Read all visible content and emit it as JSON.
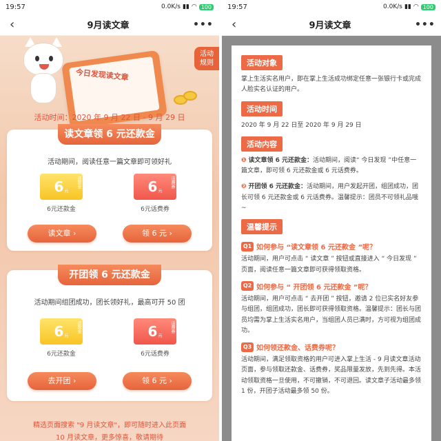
{
  "status_bar": {
    "time": "19:57",
    "net_speed": "0.0K/s",
    "battery": "100"
  },
  "nav": {
    "title": "9月读文章"
  },
  "left": {
    "rules_tab": [
      "活动",
      "规则"
    ],
    "tablet_text": "今日发现读文章",
    "activity_time": "活动时间：2020 年 9 月 22 日 - 9 月 29 日",
    "card1": {
      "title": "读文章领 6 元还款金",
      "desc": "活动期间，阅读任意一篇文章即可领好礼",
      "reward1": {
        "amount": "6",
        "unit": "元",
        "tag": "还款金",
        "label": "6元还款金"
      },
      "reward2": {
        "amount": "6",
        "unit": "元",
        "tag": "话费券",
        "label": "6元话费券"
      },
      "btn_left": "读文章 ›",
      "btn_right": "领 6 元 ›"
    },
    "card2": {
      "title": "开团领 6 元还款金",
      "desc": "活动期间组团成功，团长领好礼，最高可开 50 团",
      "reward1": {
        "amount": "6",
        "unit": "元",
        "tag": "还款金",
        "label": "6元还款金"
      },
      "reward2": {
        "amount": "6",
        "unit": "元",
        "tag": "话费券",
        "label": "6元话费券"
      },
      "btn_left": "去开团 ›",
      "btn_right": "领 6 元 ›"
    },
    "footer_line1": "精选页面搜索 \"9 月读文章\"，即可随时进入此页面",
    "footer_line2": "10 月读文章，更多惊喜，敬请期待"
  },
  "right": {
    "sec1_head": "活动对象",
    "sec1_text": "掌上生活实名用户，即在掌上生活成功绑定任意一张银行卡或完成人脸实名认证的用户。",
    "sec2_head": "活动时间",
    "sec2_text": "2020 年 9 月 22 日至 2020 年 9 月 29 日",
    "sec3_head": "活动内容",
    "sec3_item1_marker": "❶",
    "sec3_item1_bold": "读文章领 6 元还款金：",
    "sec3_item1_text": "活动期间，阅读“ 今日发现 ”中任意一篇文章，即可领 6 元还款金或 6 元话费券。",
    "sec3_item2_marker": "❷",
    "sec3_item2_bold": "开团领 6 元还款金：",
    "sec3_item2_text": "活动期间，用户发起开团，组团成功，团长可领 6 元还款金或 6 元话费券。温馨提示：团员不可领礼品哦 ~",
    "sec4_head": "温馨提示",
    "q1_badge": "Q1",
    "q1_title": "如何参与 “读文章领 6 元还款金 ”呢？",
    "q1_text": "活动期间，用户可点击 “ 读文章 ” 按钮或直接进入 “ 今日发现 ” 页面，阅读任意一篇文章即可获得领取资格。",
    "q2_badge": "Q2",
    "q2_title": "如何参与 “ 开团领 6 元还款金 ”呢？",
    "q2_text": "活动期间，用户可点击 “ 去开团 ” 按钮，邀请 2 位已实名好友参与组团，组团成功，团长即可获得领取资格。温馨提示：团长与团员均需为掌上生活实名用户，当组团人员已满时，方可视为组团成功。",
    "q3_badge": "Q3",
    "q3_title": "如何领还款金、话费券呢？",
    "q3_text": "活动期间，满足领取资格的用户可进入掌上生活 - 9 月读文章活动页面，参与领取还款金、话费券，奖品限量发放，先到先得。本活动领取资格一旦使用，不可撤销，不可退回。读文章子活动最多领 1 份，开团子活动最多领 50 份。"
  }
}
